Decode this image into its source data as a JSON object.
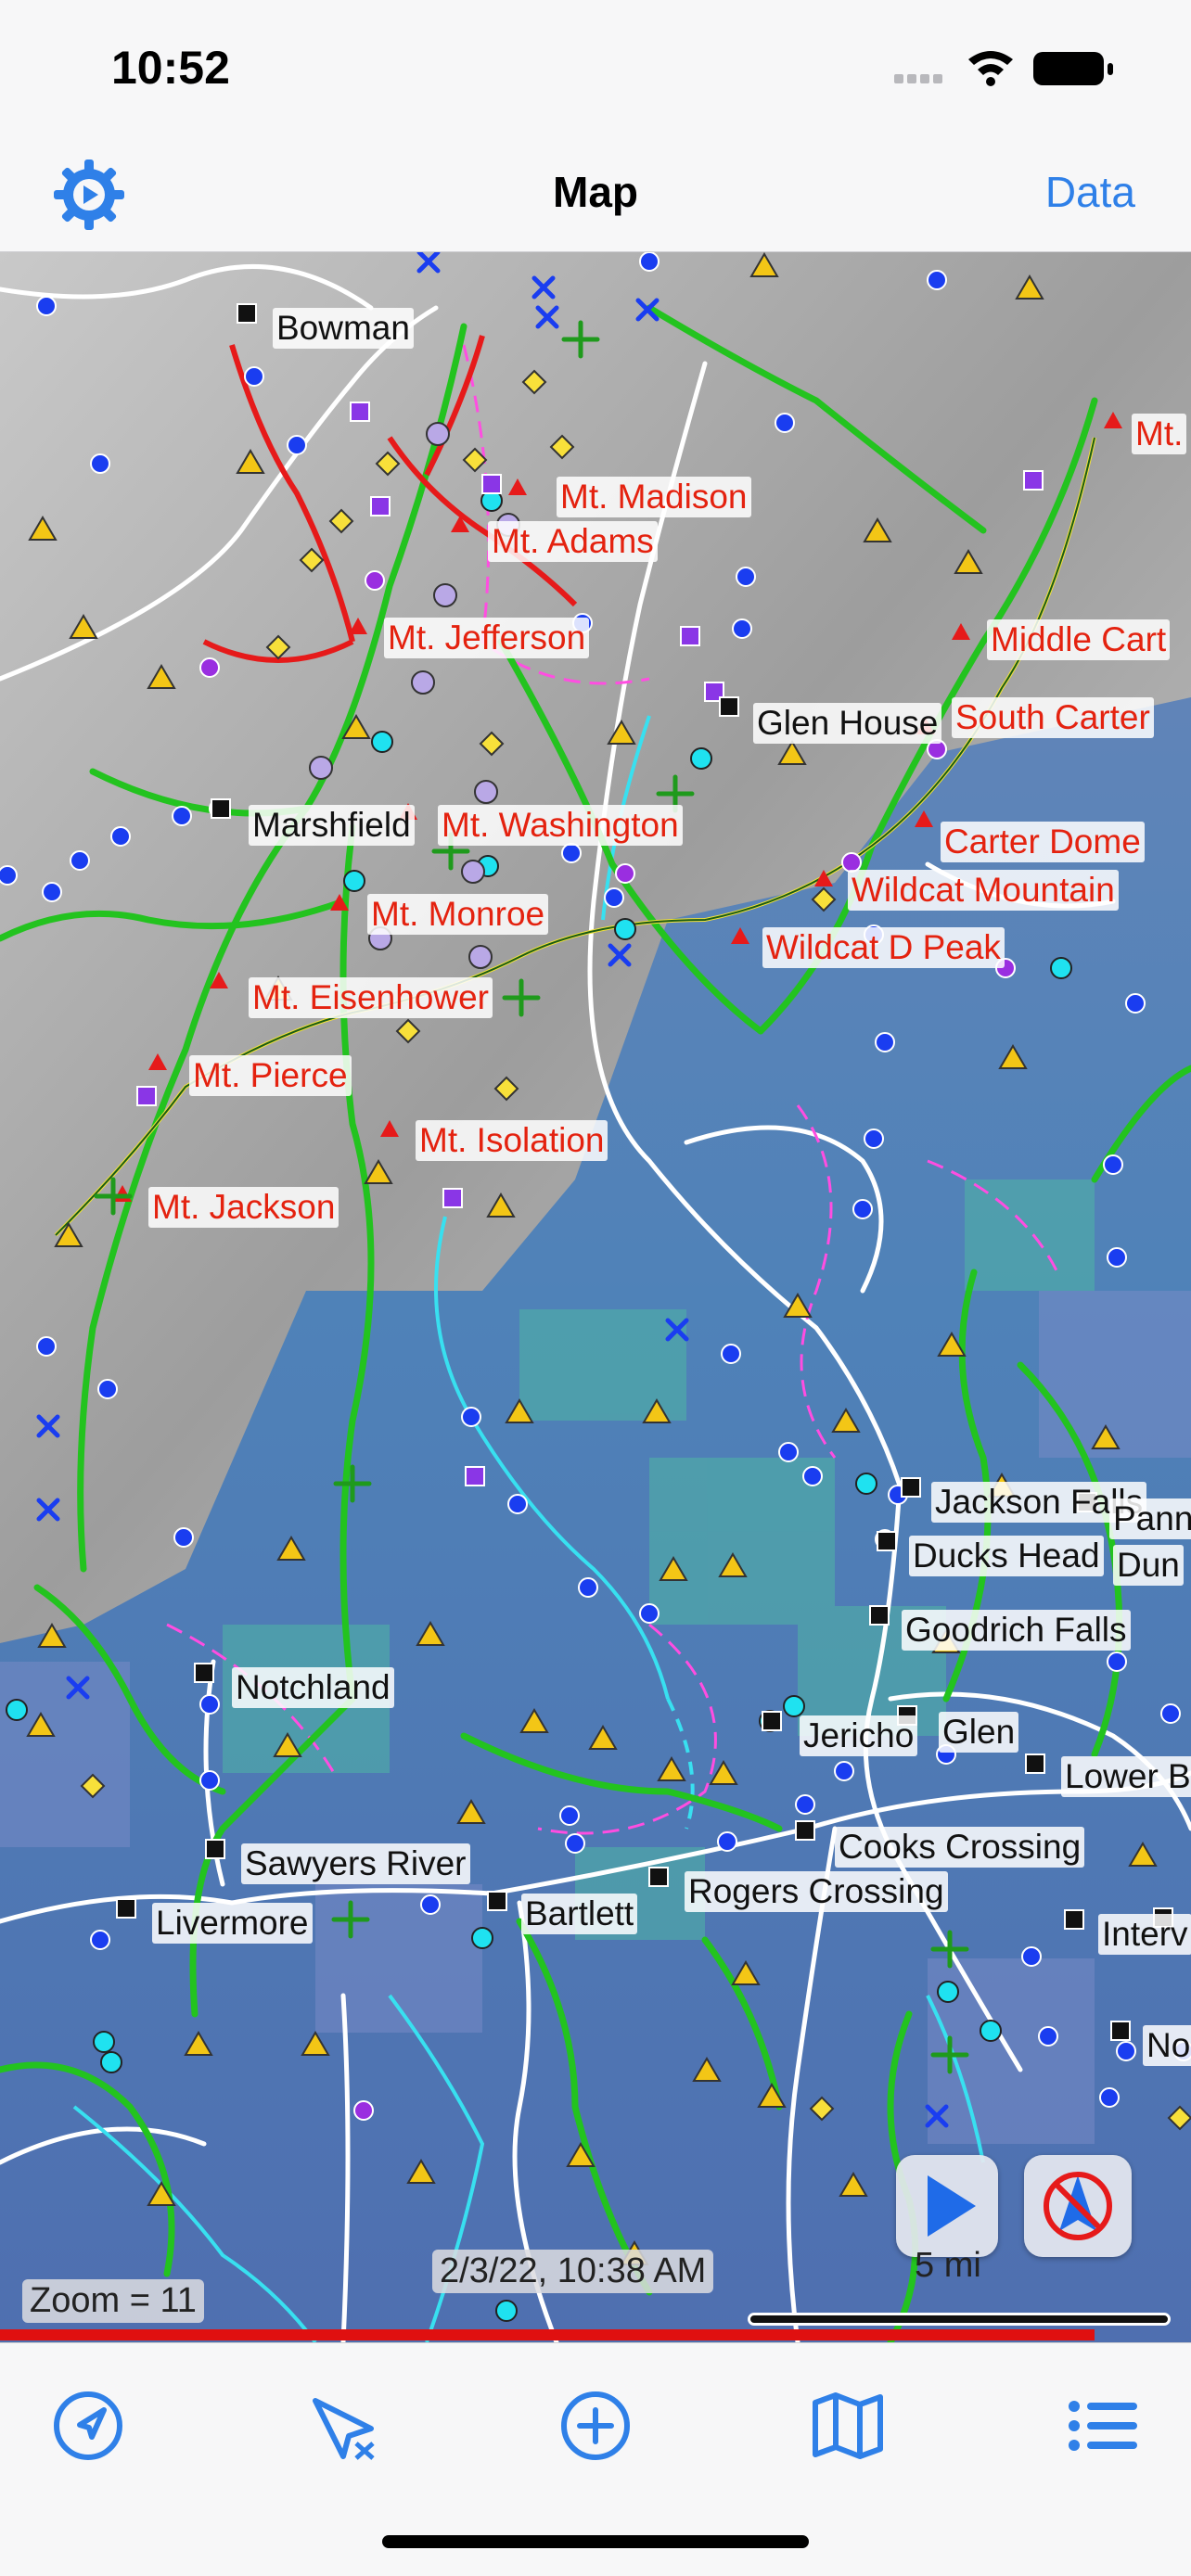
{
  "status": {
    "time": "10:52"
  },
  "nav": {
    "title": "Map",
    "right_label": "Data",
    "left_icon": "gear-icon"
  },
  "colors": {
    "accent": "#2f80e8",
    "peak_label": "#e4220f",
    "trail": "#22c922",
    "road": "#ffffff"
  },
  "map": {
    "peaks": [
      "Mt. Madison",
      "Mt. Adams",
      "Mt. Jefferson",
      "Mt. Washington",
      "Mt. Monroe",
      "Mt. Eisenhower",
      "Mt. Pierce",
      "Mt. Isolation",
      "Mt. Jackson",
      "Middle Cart",
      "South Carter",
      "Carter Dome",
      "Wildcat Mountain",
      "Wildcat D Peak",
      "Mt."
    ],
    "towns": [
      "Bowman",
      "Marshfield",
      "Glen House",
      "Notchland",
      "Sawyers River",
      "Livermore",
      "Bartlett",
      "Rogers Crossing",
      "Cooks Crossing",
      "Jericho",
      "Glen",
      "Goodrich Falls",
      "Ducks Head",
      "Jackson Falls",
      "Pann",
      "Dun",
      "Lower B",
      "Interv",
      "No"
    ],
    "timestamp": "2/3/22, 10:38 AM",
    "zoom": "Zoom = 11",
    "scale": "5 mi"
  },
  "tabs": [
    {
      "icon": "location-arrow-icon"
    },
    {
      "icon": "route-icon"
    },
    {
      "icon": "add-circle-icon"
    },
    {
      "icon": "map-icon"
    },
    {
      "icon": "list-icon"
    }
  ]
}
